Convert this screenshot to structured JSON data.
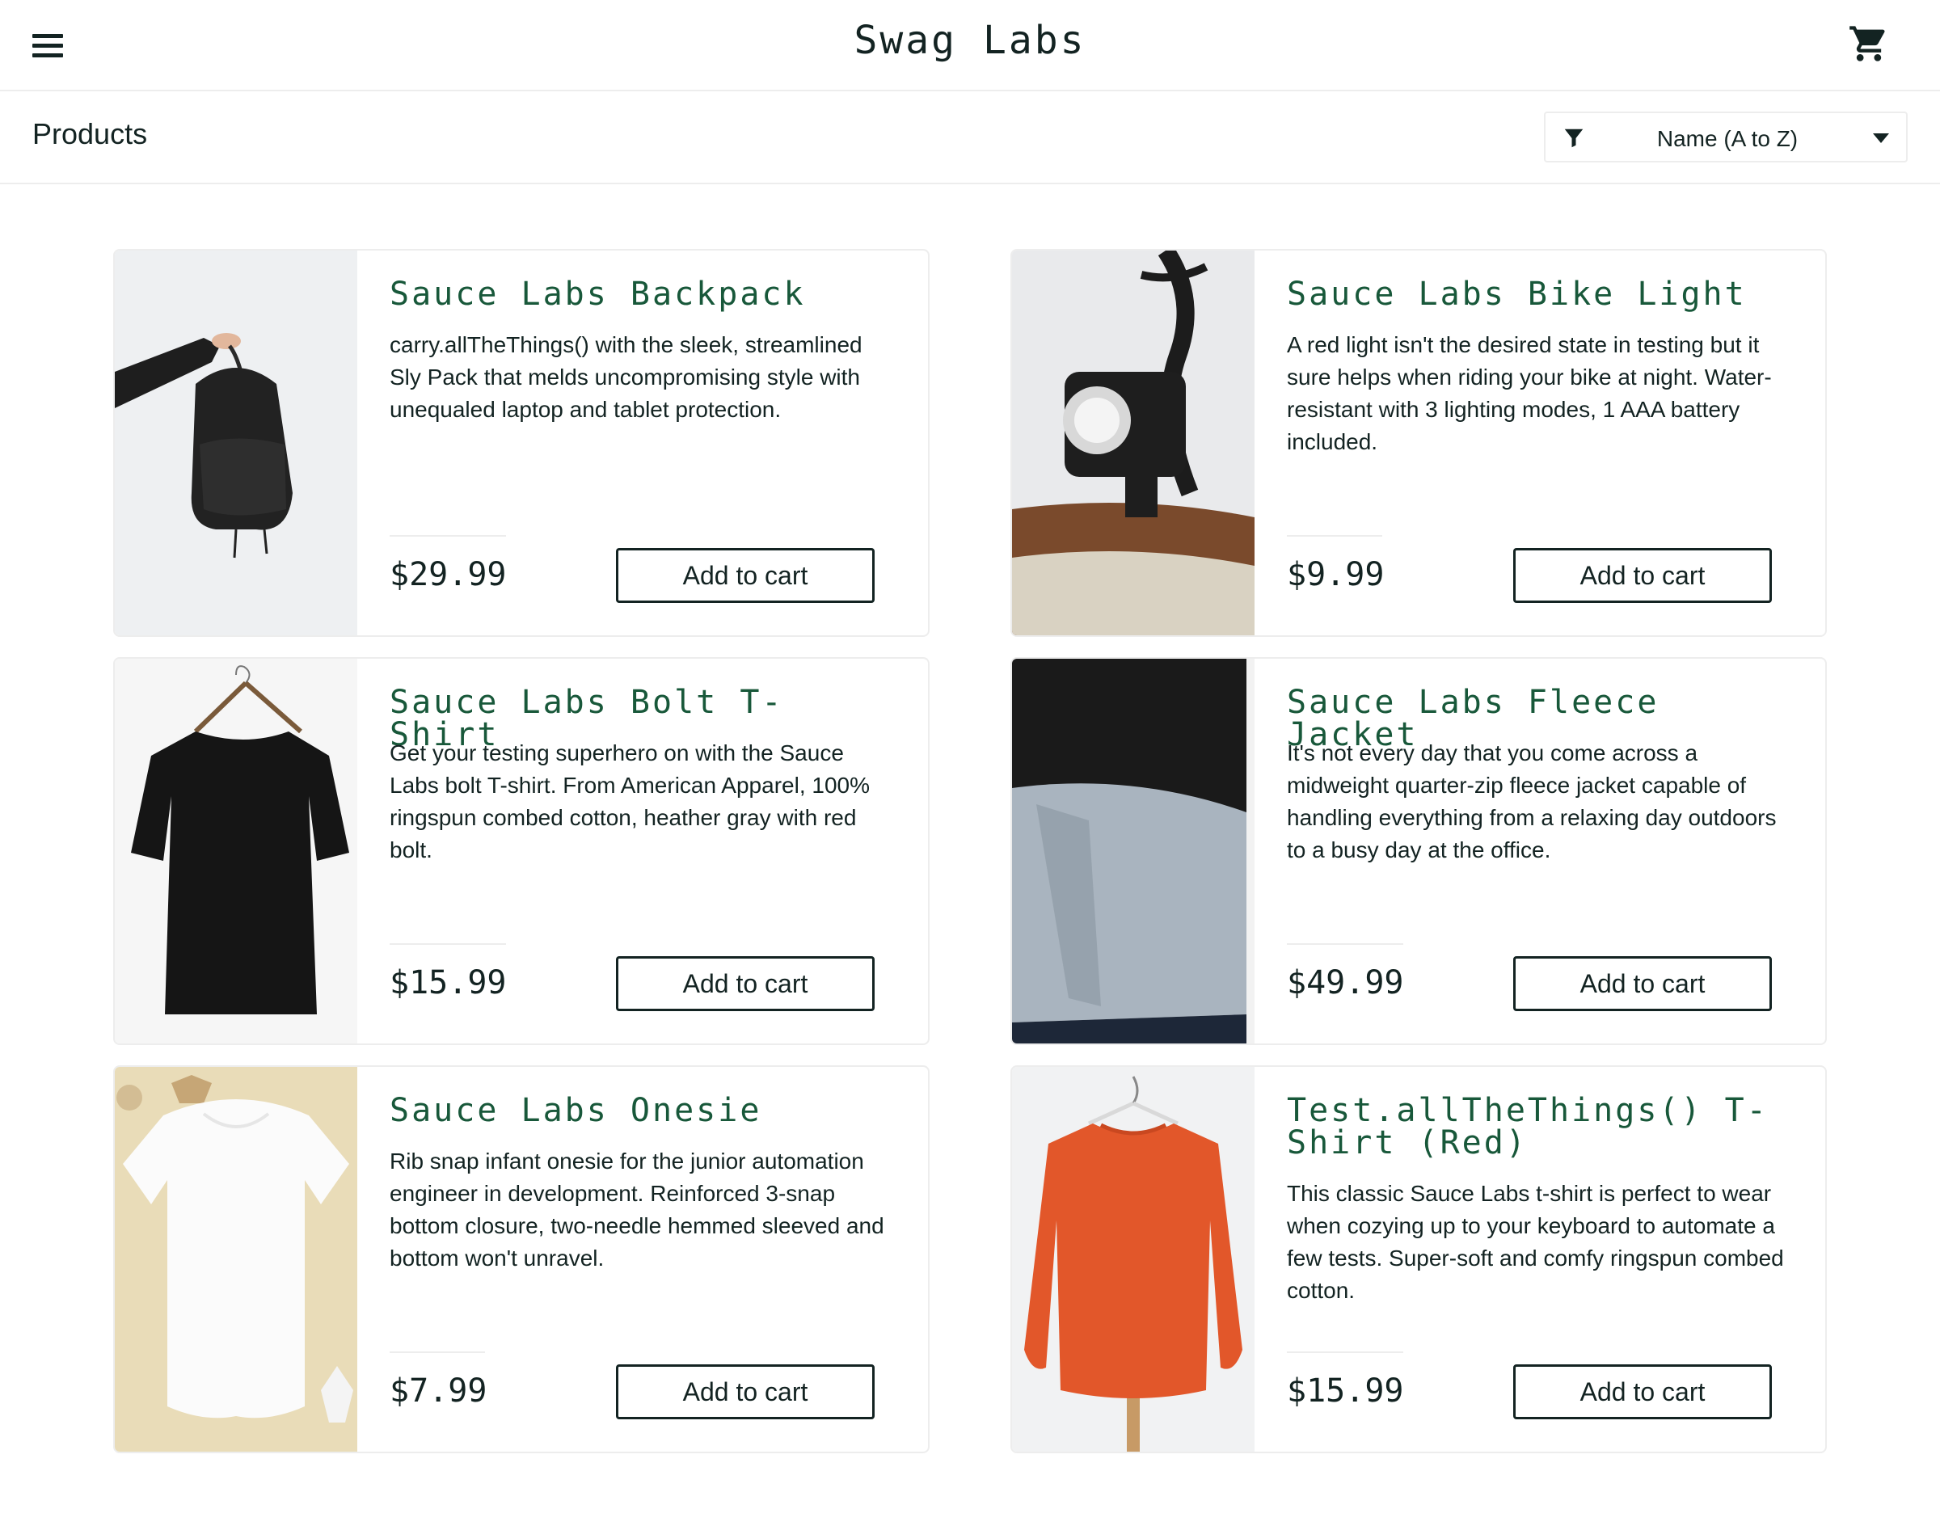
{
  "header": {
    "title": "Swag Labs",
    "menu_icon": "hamburger-menu-icon",
    "cart_icon": "shopping-cart-icon"
  },
  "subheader": {
    "title": "Products",
    "sort": {
      "selected": "Name (A to Z)",
      "icon": "filter-icon",
      "caret": "caret-down-icon"
    }
  },
  "colors": {
    "name_link": "#18583a",
    "text": "#132322",
    "border": "#ededed"
  },
  "items": [
    {
      "name": "Sauce Labs Backpack",
      "desc": "carry.allTheThings() with the sleek, streamlined Sly Pack that melds uncompromising style with unequaled laptop and tablet protection.",
      "price": "$29.99",
      "button": "Add to cart",
      "image": "backpack"
    },
    {
      "name": "Sauce Labs Bike Light",
      "desc": "A red light isn't the desired state in testing but it sure helps when riding your bike at night. Water-resistant with 3 lighting modes, 1 AAA battery included.",
      "price": "$9.99",
      "button": "Add to cart",
      "image": "bike-light"
    },
    {
      "name": "Sauce Labs Bolt T-Shirt",
      "desc": "Get your testing superhero on with the Sauce Labs bolt T-shirt. From American Apparel, 100% ringspun combed cotton, heather gray with red bolt.",
      "price": "$15.99",
      "button": "Add to cart",
      "image": "black-tshirt"
    },
    {
      "name": "Sauce Labs Fleece Jacket",
      "desc": "It's not every day that you come across a midweight quarter-zip fleece jacket capable of handling everything from a relaxing day outdoors to a busy day at the office.",
      "price": "$49.99",
      "button": "Add to cart",
      "image": "fleece-jacket"
    },
    {
      "name": "Sauce Labs Onesie",
      "desc": "Rib snap infant onesie for the junior automation engineer in development. Reinforced 3-snap bottom closure, two-needle hemmed sleeved and bottom won't unravel.",
      "price": "$7.99",
      "button": "Add to cart",
      "image": "onesie"
    },
    {
      "name": "Test.allTheThings() T-Shirt (Red)",
      "desc": "This classic Sauce Labs t-shirt is perfect to wear when cozying up to your keyboard to automate a few tests. Super-soft and comfy ringspun combed cotton.",
      "price": "$15.99",
      "button": "Add to cart",
      "image": "red-sweatshirt"
    }
  ]
}
